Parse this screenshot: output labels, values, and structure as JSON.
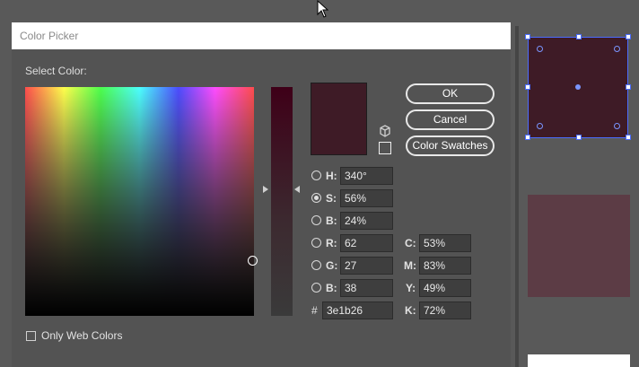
{
  "dialog": {
    "title": "Color Picker",
    "select_label": "Select Color:",
    "only_web_colors": "Only Web Colors",
    "buttons": {
      "ok": "OK",
      "cancel": "Cancel",
      "swatches": "Color Swatches"
    },
    "current_color": "#3e1b26",
    "hsb": [
      {
        "label": "H:",
        "value": "340°",
        "selected": false
      },
      {
        "label": "S:",
        "value": "56%",
        "selected": true
      },
      {
        "label": "B:",
        "value": "24%",
        "selected": false
      }
    ],
    "rgb": [
      {
        "label": "R:",
        "value": "62"
      },
      {
        "label": "G:",
        "value": "27"
      },
      {
        "label": "B:",
        "value": "38"
      }
    ],
    "cmyk": [
      {
        "label": "C:",
        "value": "53%"
      },
      {
        "label": "M:",
        "value": "83%"
      },
      {
        "label": "Y:",
        "value": "49%"
      },
      {
        "label": "K:",
        "value": "72%"
      }
    ],
    "hex": {
      "label": "#",
      "value": "3e1b26"
    }
  },
  "colors": {
    "selected_rect": "#3e1b26",
    "second_rect": "#5c3c45",
    "selection_blue": "#4a6cff"
  },
  "icons": {
    "cube": "cube-icon",
    "cursor": "mouse-pointer-icon"
  }
}
